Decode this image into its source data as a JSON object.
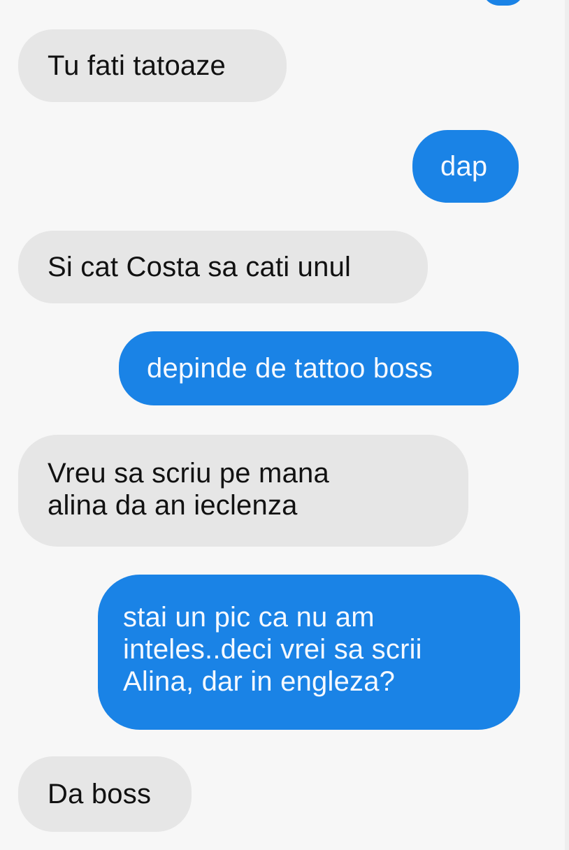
{
  "colors": {
    "background": "#f7f7f7",
    "incoming_bubble": "#e6e6e6",
    "outgoing_bubble": "#1a83e6",
    "incoming_text": "#111111",
    "outgoing_text": "#f5f9ff"
  },
  "messages": [
    {
      "direction": "incoming",
      "text": "Tu fati tatoaze"
    },
    {
      "direction": "outgoing",
      "text": "dap"
    },
    {
      "direction": "incoming",
      "text": "Si cat Costa sa cati unul"
    },
    {
      "direction": "outgoing",
      "text": "depinde de tattoo boss"
    },
    {
      "direction": "incoming",
      "text": "Vreu sa scriu pe mana\nalina da an ieclenza"
    },
    {
      "direction": "outgoing",
      "text": "stai un pic ca nu am\ninteles..deci vrei sa scrii\nAlina, dar in engleza?"
    },
    {
      "direction": "incoming",
      "text": "Da boss"
    }
  ]
}
